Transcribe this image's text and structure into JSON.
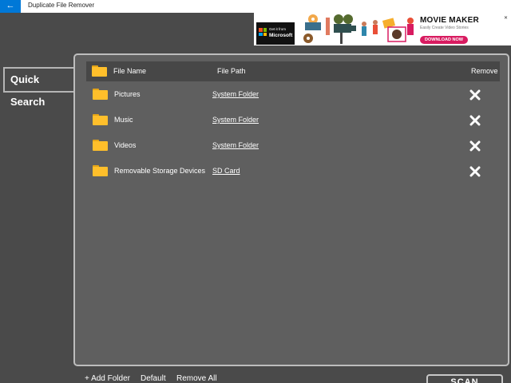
{
  "window": {
    "title": "Duplicate File Remover",
    "back_icon": "arrow-left-icon",
    "accent": "#0078d7"
  },
  "ad": {
    "store_badge_line1": "Get it from",
    "store_badge_line2": "Microsoft",
    "title": "MOVIE MAKER",
    "subtitle": "Easily Create Video Stories",
    "cta": "DOWNLOAD NOW",
    "cta_color": "#d81b60"
  },
  "sidebar": {
    "quick_search_label": "Quick Search"
  },
  "table": {
    "headers": {
      "file_name": "File Name",
      "file_path": "File Path",
      "remove": "Remove"
    },
    "rows": [
      {
        "name": "Pictures",
        "path": "System Folder"
      },
      {
        "name": "Music",
        "path": "System Folder"
      },
      {
        "name": "Videos",
        "path": "System Folder"
      },
      {
        "name": "Removable Storage Devices",
        "path": "SD Card"
      }
    ],
    "folder_icon": "folder-icon",
    "folder_color": "#ffbf2b",
    "remove_icon": "close-icon"
  },
  "footer": {
    "add_folder": "+ Add Folder",
    "default": "Default",
    "remove_all": "Remove All",
    "scan": "SCAN"
  }
}
